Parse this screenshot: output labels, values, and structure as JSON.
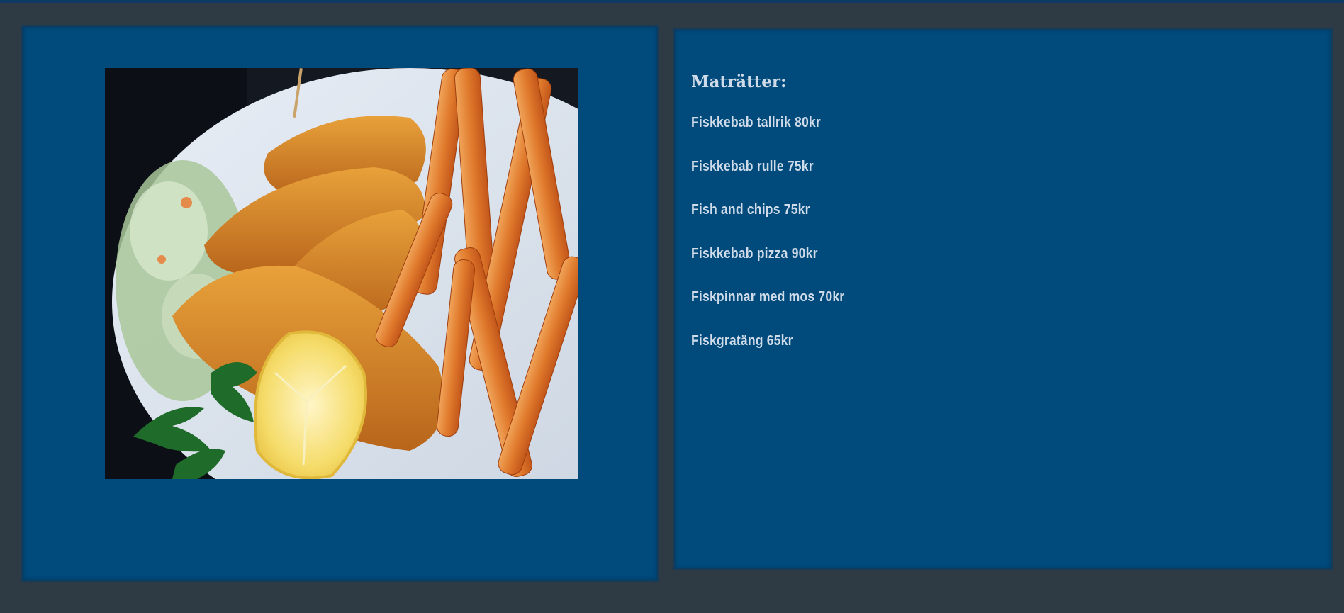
{
  "menu": {
    "heading": "Maträtter:",
    "items": [
      {
        "label": "Fiskkebab tallrik 80kr"
      },
      {
        "label": "Fiskkebab rulle 75kr"
      },
      {
        "label": "Fish and chips 75kr"
      },
      {
        "label": "Fiskkebab pizza 90kr"
      },
      {
        "label": "Fiskpinnar med mos 70kr"
      },
      {
        "label": "Fiskgratäng 65kr"
      }
    ]
  },
  "colors": {
    "page_background": "#2e3a44",
    "panel_background": "#004a7c",
    "text": "#cfdbe8"
  },
  "image": {
    "icon": "fish-and-chips-photo"
  }
}
